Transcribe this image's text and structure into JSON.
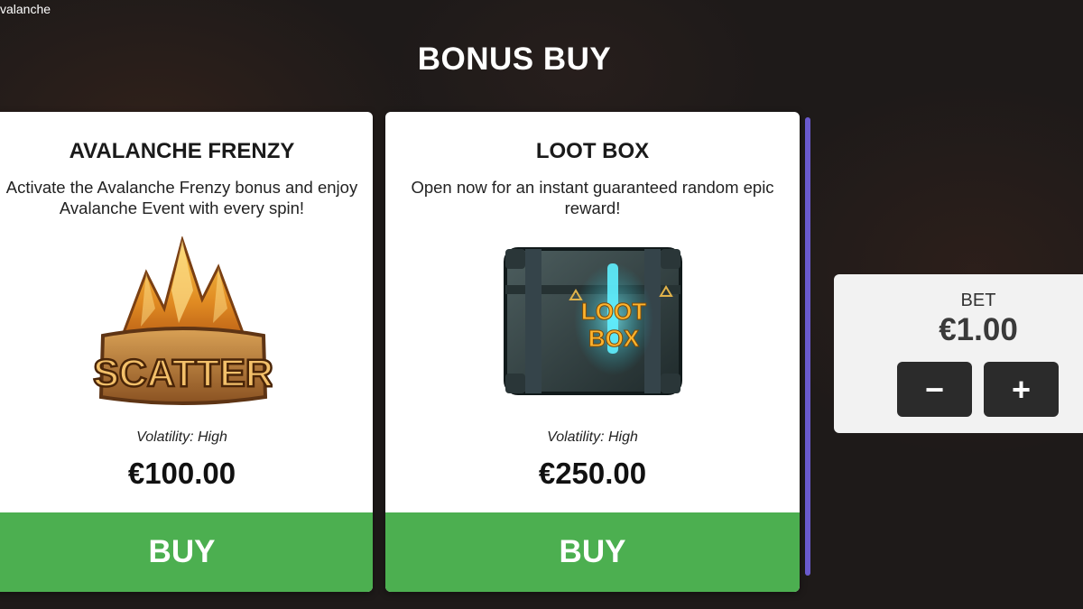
{
  "app": {
    "title": "valanche"
  },
  "header": {
    "title": "BONUS BUY"
  },
  "cards": [
    {
      "title": "AVALANCHE FRENZY",
      "description": "Activate the Avalanche Frenzy bonus and enjoy Avalanche Event with every spin!",
      "image_text": "SCATTER",
      "volatility": "Volatility: High",
      "price": "€100.00",
      "buy_label": "BUY"
    },
    {
      "title": "LOOT BOX",
      "description": "Open now for an instant guaranteed random epic reward!",
      "image_text_1": "LOOT",
      "image_text_2": "BOX",
      "volatility": "Volatility: High",
      "price": "€250.00",
      "buy_label": "BUY"
    }
  ],
  "bet": {
    "label": "BET",
    "value": "€1.00",
    "minus_label": "−",
    "plus_label": "+"
  },
  "colors": {
    "buy_green": "#4caf50",
    "scrollbar": "#6a5acd",
    "panel_bg": "#f2f2f2",
    "bet_button": "#2b2b2b"
  }
}
